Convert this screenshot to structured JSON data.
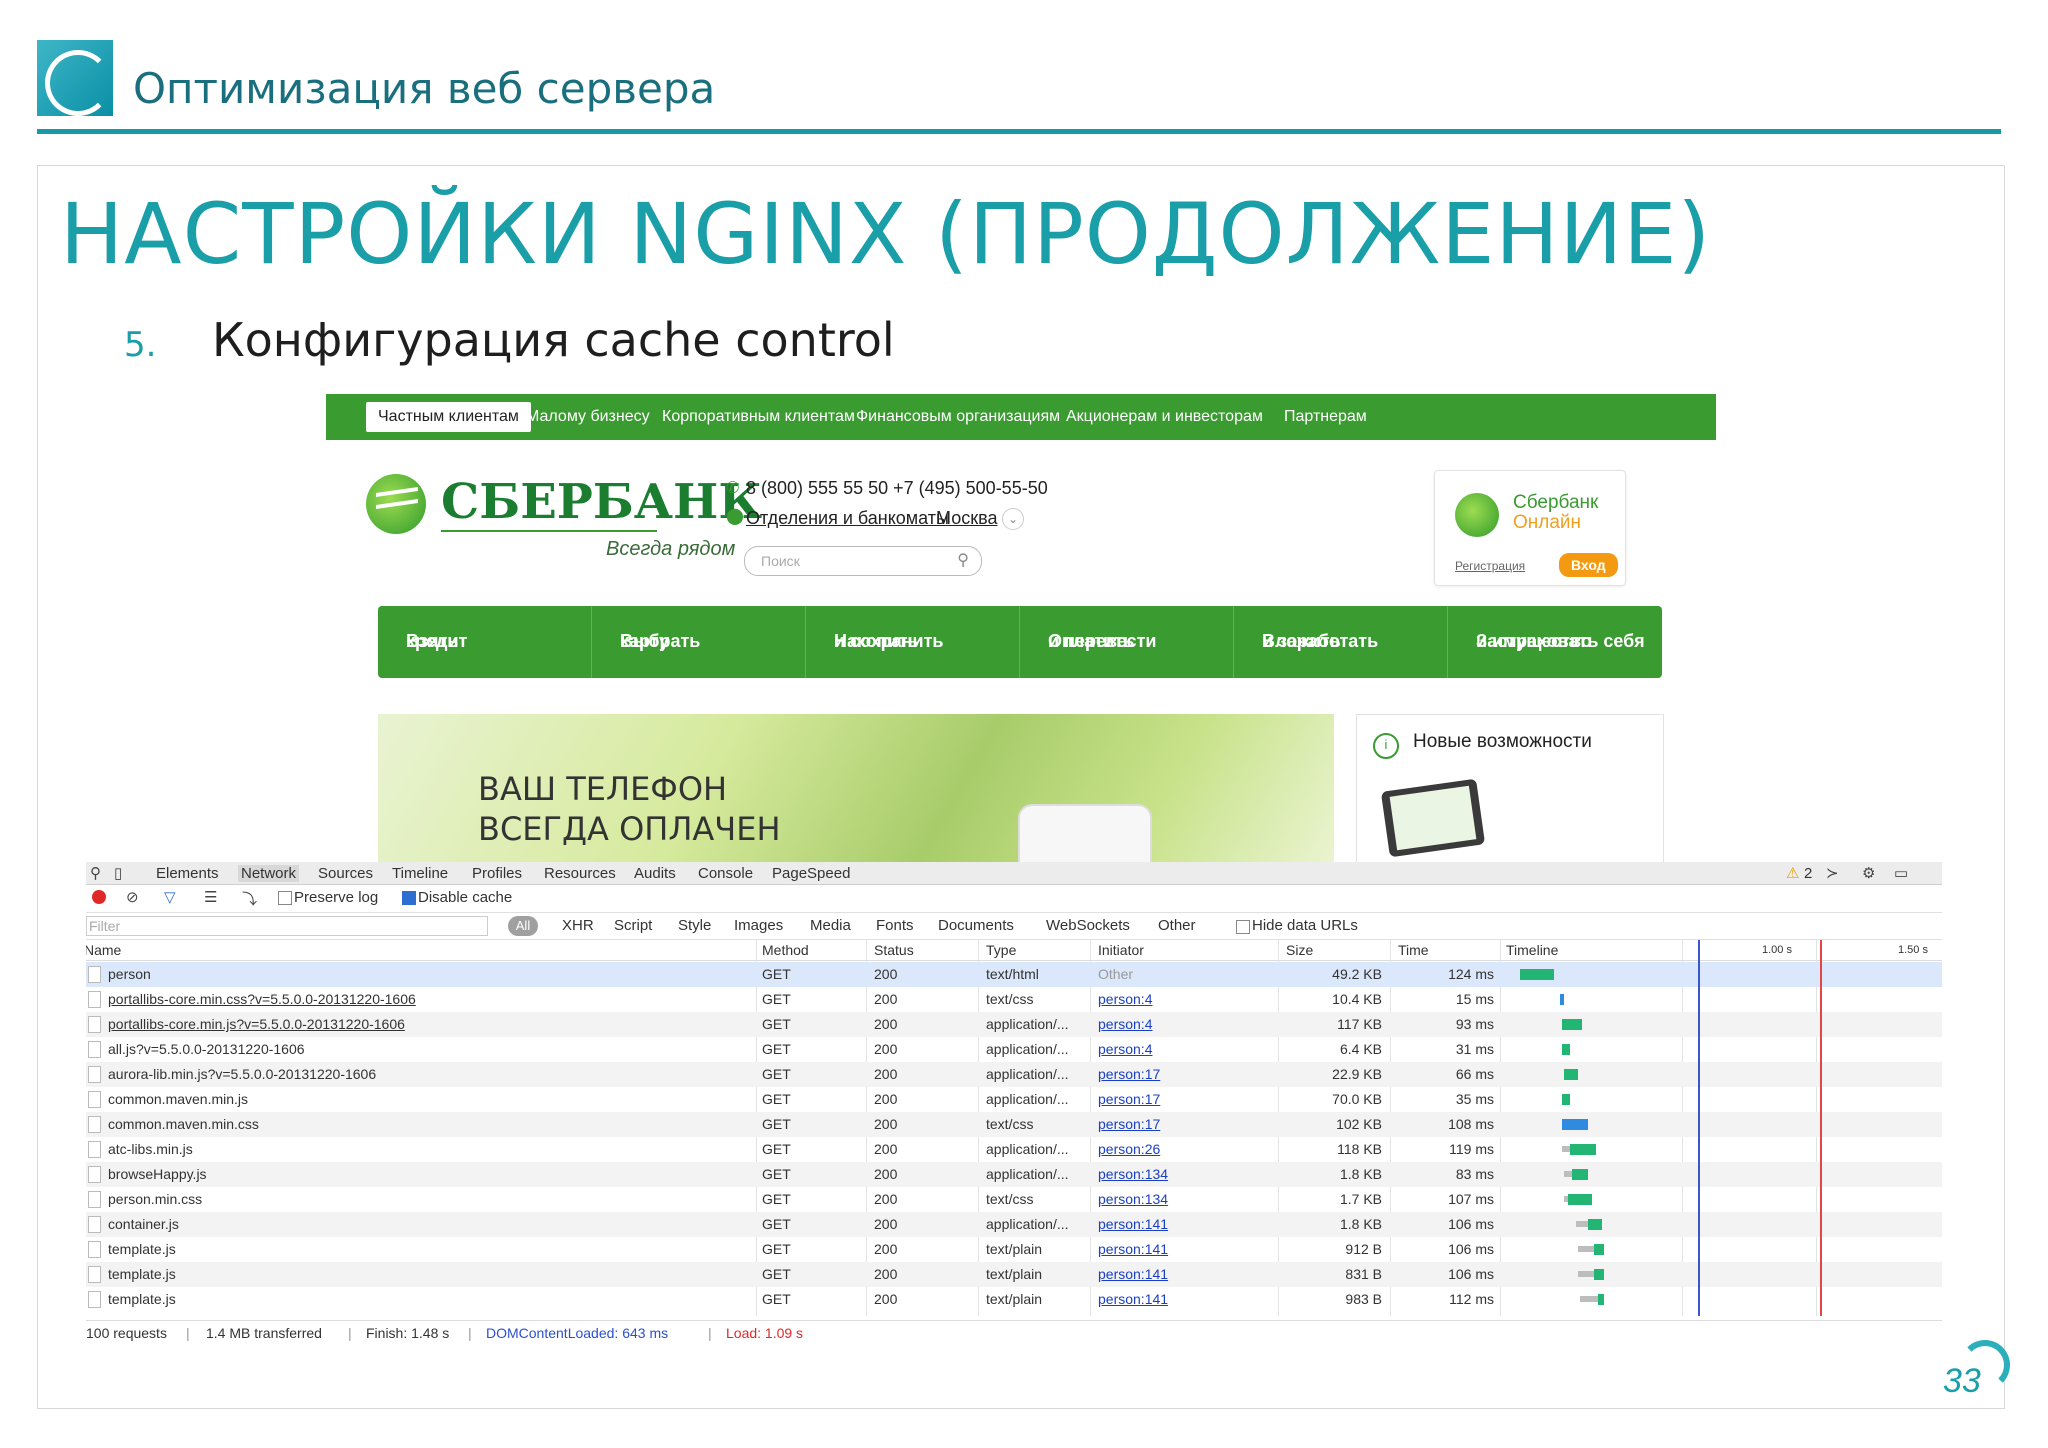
{
  "deck": {
    "title": "Оптимизация веб сервера",
    "slide_title": "НАСТРОЙКИ NGINX (ПРОДОЛЖЕНИЕ)",
    "bullet_number": "5.",
    "bullet_text": "Конфигурация cache control",
    "page_number": "33",
    "accent_color": "#1a9ea8"
  },
  "site": {
    "top_nav": [
      "Частным клиентам",
      "Малому бизнесу",
      "Корпоративным клиентам",
      "Финансовым организациям",
      "Акционерам и инвесторам",
      "Партнерам"
    ],
    "brand": "СБЕРБАНК",
    "slogan": "Всегда рядом",
    "phones": "8 (800) 555 55 50    +7 (495) 500-55-50",
    "branches_link": "Отделения и банкоматы",
    "city": "Москва",
    "search_placeholder": "Поиск",
    "online": {
      "line1": "Сбербанк",
      "line2": "Онлайн",
      "register": "Регистрация",
      "login": "Вход"
    },
    "menu": [
      {
        "l1": "Взять",
        "l2": "кредит"
      },
      {
        "l1": "Выбрать",
        "l2": "карту"
      },
      {
        "l1": "Накопить",
        "l2": "и сохранить"
      },
      {
        "l1": "Оплатить",
        "l2": "и перевести"
      },
      {
        "l1": "Вложить",
        "l2": "и заработать"
      },
      {
        "l1": "Застраховать себя",
        "l2": "и имущество"
      }
    ],
    "banner_l1": "ВАШ ТЕЛЕФОН",
    "banner_l2": "ВСЕГДА ОПЛАЧЕН",
    "news_title": "Новые возможности",
    "brand_color": "#3a9b30"
  },
  "devtools": {
    "tabs": [
      "Elements",
      "Network",
      "Sources",
      "Timeline",
      "Profiles",
      "Resources",
      "Audits",
      "Console",
      "PageSpeed"
    ],
    "warnings": "2",
    "preserve_log": "Preserve log",
    "disable_cache": "Disable cache",
    "filter_placeholder": "Filter",
    "type_filters": [
      "All",
      "XHR",
      "Script",
      "Style",
      "Images",
      "Media",
      "Fonts",
      "Documents",
      "WebSockets",
      "Other"
    ],
    "hide_data_urls": "Hide data URLs",
    "columns": [
      "Name",
      "Method",
      "Status",
      "Type",
      "Initiator",
      "Size",
      "Time",
      "Timeline"
    ],
    "timeline_ticks": [
      "1.00 s",
      "1.50 s"
    ],
    "rows": [
      {
        "name": "person",
        "method": "GET",
        "status": "200",
        "type": "text/html",
        "initiator": "Other",
        "size": "49.2 KB",
        "time": "124 ms"
      },
      {
        "name": "portallibs-core.min.css?v=5.5.0.0-20131220-1606",
        "method": "GET",
        "status": "200",
        "type": "text/css",
        "initiator": "person:4",
        "size": "10.4 KB",
        "time": "15 ms"
      },
      {
        "name": "portallibs-core.min.js?v=5.5.0.0-20131220-1606",
        "method": "GET",
        "status": "200",
        "type": "application/...",
        "initiator": "person:4",
        "size": "117 KB",
        "time": "93 ms"
      },
      {
        "name": "all.js?v=5.5.0.0-20131220-1606",
        "method": "GET",
        "status": "200",
        "type": "application/...",
        "initiator": "person:4",
        "size": "6.4 KB",
        "time": "31 ms"
      },
      {
        "name": "aurora-lib.min.js?v=5.5.0.0-20131220-1606",
        "method": "GET",
        "status": "200",
        "type": "application/...",
        "initiator": "person:17",
        "size": "22.9 KB",
        "time": "66 ms"
      },
      {
        "name": "common.maven.min.js",
        "method": "GET",
        "status": "200",
        "type": "application/...",
        "initiator": "person:17",
        "size": "70.0 KB",
        "time": "35 ms"
      },
      {
        "name": "common.maven.min.css",
        "method": "GET",
        "status": "200",
        "type": "text/css",
        "initiator": "person:17",
        "size": "102 KB",
        "time": "108 ms"
      },
      {
        "name": "atc-libs.min.js",
        "method": "GET",
        "status": "200",
        "type": "application/...",
        "initiator": "person:26",
        "size": "118 KB",
        "time": "119 ms"
      },
      {
        "name": "browseHappy.js",
        "method": "GET",
        "status": "200",
        "type": "application/...",
        "initiator": "person:134",
        "size": "1.8 KB",
        "time": "83 ms"
      },
      {
        "name": "person.min.css",
        "method": "GET",
        "status": "200",
        "type": "text/css",
        "initiator": "person:134",
        "size": "1.7 KB",
        "time": "107 ms"
      },
      {
        "name": "container.js",
        "method": "GET",
        "status": "200",
        "type": "application/...",
        "initiator": "person:141",
        "size": "1.8 KB",
        "time": "106 ms"
      },
      {
        "name": "template.js",
        "method": "GET",
        "status": "200",
        "type": "text/plain",
        "initiator": "person:141",
        "size": "912 B",
        "time": "106 ms"
      },
      {
        "name": "template.js",
        "method": "GET",
        "status": "200",
        "type": "text/plain",
        "initiator": "person:141",
        "size": "831 B",
        "time": "106 ms"
      },
      {
        "name": "template.js",
        "method": "GET",
        "status": "200",
        "type": "text/plain",
        "initiator": "person:141",
        "size": "983 B",
        "time": "112 ms"
      }
    ],
    "footer": {
      "requests": "100 requests",
      "transferred": "1.4 MB transferred",
      "finish": "Finish: 1.48 s",
      "dcl": "DOMContentLoaded: 643 ms",
      "load": "Load: 1.09 s"
    }
  }
}
